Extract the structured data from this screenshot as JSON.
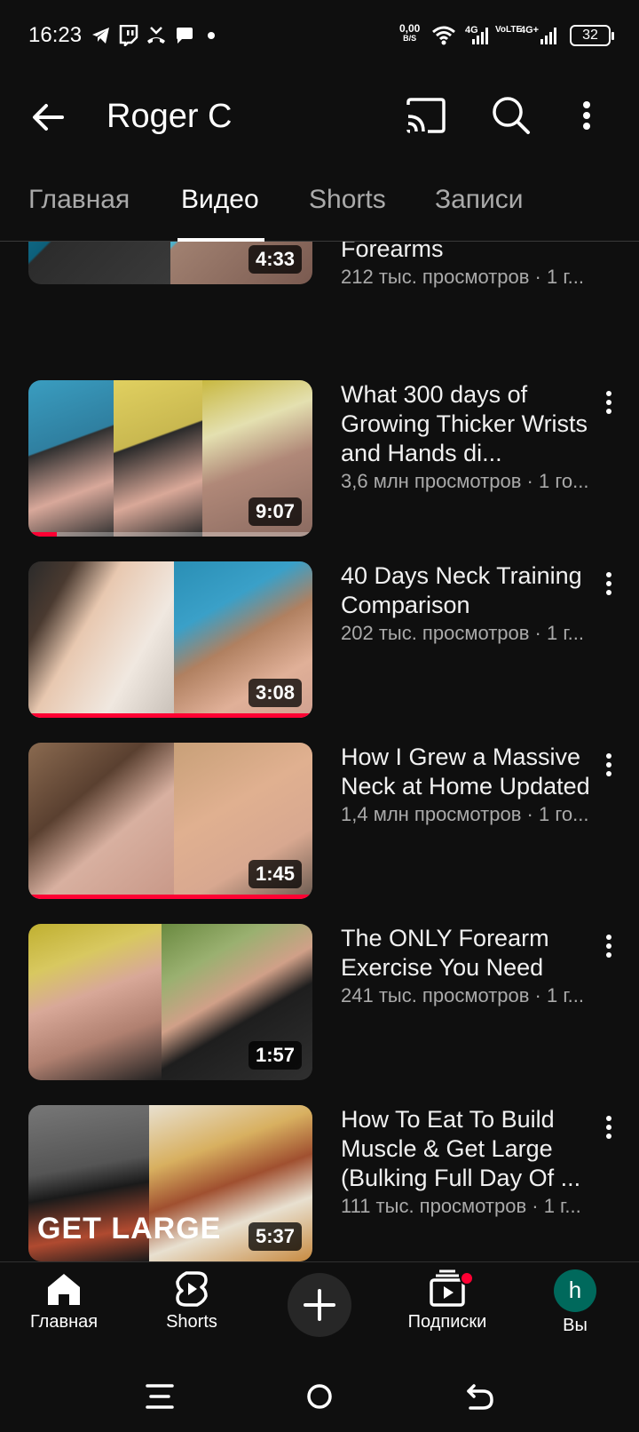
{
  "status_bar": {
    "time": "16:23",
    "net_speed_value": "0,00",
    "net_speed_unit": "B/S",
    "network_1": "4G",
    "network_2": "VoLTE",
    "network_3": "4G+",
    "battery": "32",
    "notification_icons": [
      "telegram-icon",
      "twitch-icon",
      "missed-call-icon",
      "chat-icon",
      "dot-icon"
    ]
  },
  "header": {
    "channel_name": "Roger C",
    "icons": [
      "back-arrow-icon",
      "cast-icon",
      "search-icon",
      "more-vert-icon"
    ]
  },
  "tabs": [
    {
      "label": "Главная",
      "active": false
    },
    {
      "label": "Видео",
      "active": true
    },
    {
      "label": "Shorts",
      "active": false
    },
    {
      "label": "Записи",
      "active": false
    }
  ],
  "videos": [
    {
      "title": "Forearms",
      "meta": "212 тыс. просмотров · 1 г...",
      "duration": "4:33",
      "watched": 0
    },
    {
      "title": "What 300 days of Growing Thicker Wrists and Hands di...",
      "meta": "3,6 млн просмотров · 1 го...",
      "duration": "9:07",
      "watched": 0.1
    },
    {
      "title": "40 Days Neck Training Comparison",
      "meta": "202 тыс. просмотров · 1 г...",
      "duration": "3:08",
      "watched": 1.0
    },
    {
      "title": "How I Grew a Massive Neck at Home Updated",
      "meta": "1,4 млн просмотров · 1 го...",
      "duration": "1:45",
      "watched": 1.0
    },
    {
      "title": "The ONLY Forearm Exercise You Need",
      "meta": "241 тыс. просмотров · 1 г...",
      "duration": "1:57",
      "watched": 0
    },
    {
      "title": "How To Eat To Build Muscle & Get Large (Bulking Full Day Of ...",
      "meta": "111 тыс. просмотров · 1 г...",
      "duration": "5:37",
      "watched": 0,
      "thumb_text": "GET LARGE"
    }
  ],
  "bottom_nav": {
    "home": "Главная",
    "shorts": "Shorts",
    "subscriptions": "Подписки",
    "you": "Вы",
    "avatar_letter": "h"
  },
  "colors": {
    "background": "#0f0f0f",
    "progress": "#ff0033",
    "secondary_text": "#aaaaaa",
    "avatar": "#00695c"
  }
}
